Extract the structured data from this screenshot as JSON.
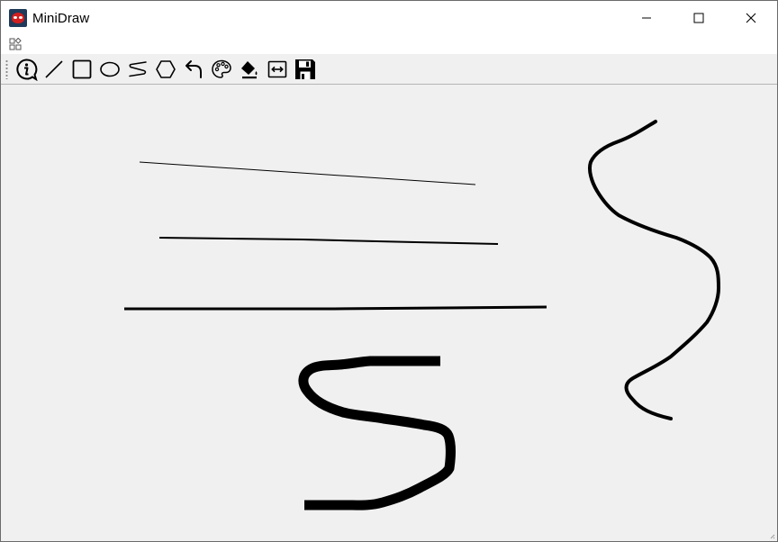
{
  "window": {
    "title": "MiniDraw",
    "controls": [
      "minimize-icon",
      "maximize-icon",
      "close-icon"
    ]
  },
  "menubar": {
    "icon": "menu-grid-icon"
  },
  "toolbar": {
    "tools": [
      {
        "name": "info",
        "icon": "info-icon"
      },
      {
        "name": "line",
        "icon": "line-icon"
      },
      {
        "name": "rectangle",
        "icon": "rectangle-icon"
      },
      {
        "name": "ellipse",
        "icon": "ellipse-icon"
      },
      {
        "name": "freehand",
        "icon": "freehand-icon"
      },
      {
        "name": "polygon",
        "icon": "polygon-icon"
      },
      {
        "name": "undo",
        "icon": "undo-icon"
      },
      {
        "name": "color",
        "icon": "palette-icon"
      },
      {
        "name": "fill",
        "icon": "paint-bucket-icon"
      },
      {
        "name": "width",
        "icon": "line-width-icon"
      },
      {
        "name": "save",
        "icon": "save-icon"
      }
    ]
  },
  "canvas": {
    "stroke_color": "#000000",
    "background": "#f0f0f0",
    "shapes": [
      {
        "type": "line",
        "width": 1
      },
      {
        "type": "line",
        "width": 2
      },
      {
        "type": "line",
        "width": 3
      },
      {
        "type": "freehand",
        "width": 4
      },
      {
        "type": "freehand",
        "width": 11
      }
    ]
  }
}
